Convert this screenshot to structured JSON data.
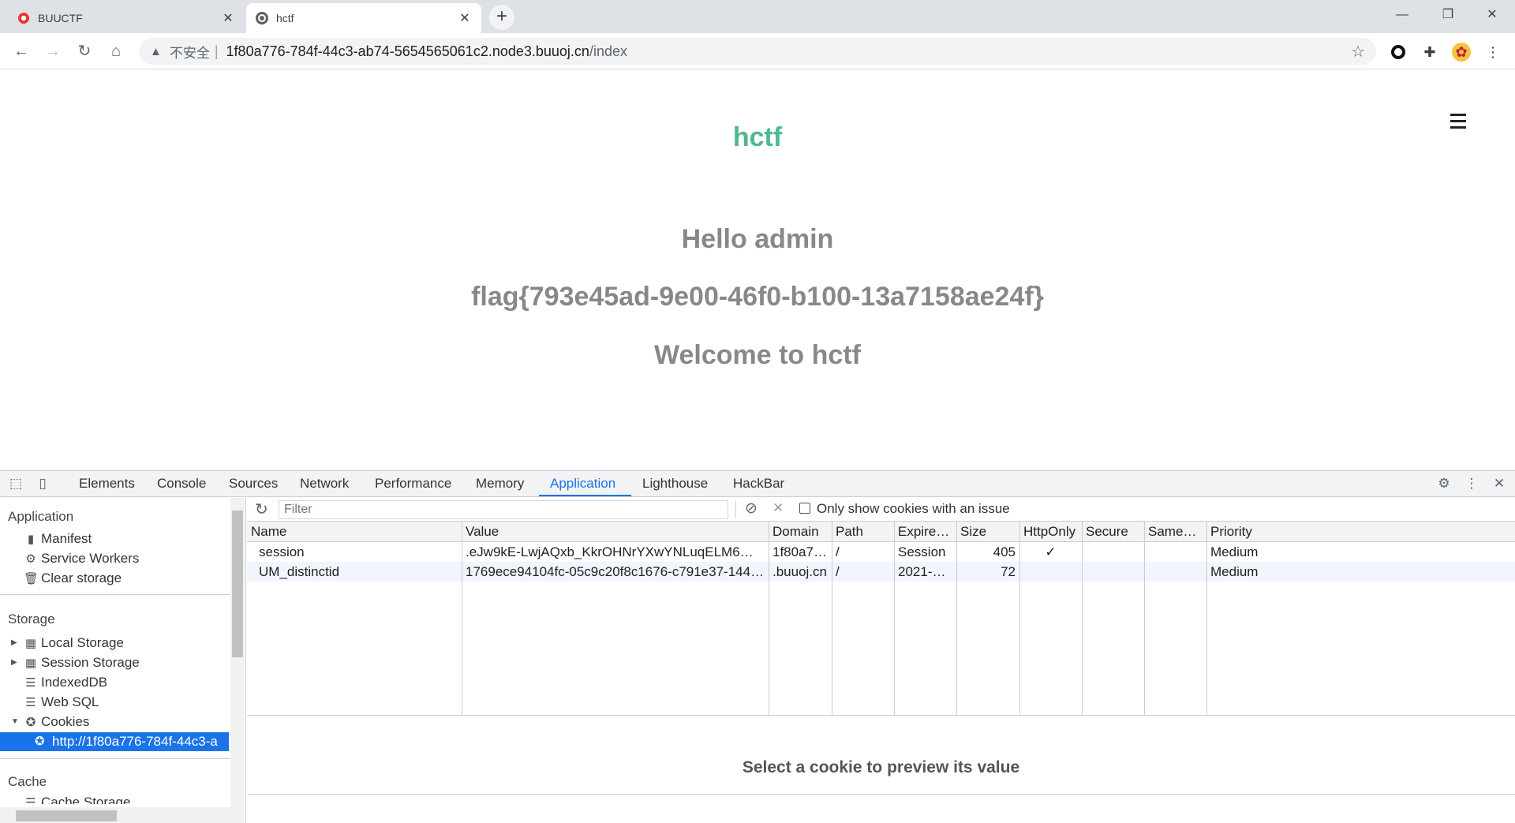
{
  "browser": {
    "tabs": [
      {
        "title": "BUUCTF",
        "favicon": "buuctf-logo-icon",
        "active": false
      },
      {
        "title": "hctf",
        "favicon": "globe-icon",
        "active": true
      }
    ],
    "address": {
      "security_label": "不安全",
      "host": "1f80a776-784f-44c3-ab74-5654565061c2.node3.buuoj.cn",
      "path": "/index"
    }
  },
  "page": {
    "brand": "hctf",
    "greeting": "Hello admin",
    "flag": "flag{793e45ad-9e00-46f0-b100-13a7158ae24f}",
    "welcome": "Welcome to hctf"
  },
  "devtools": {
    "tabs": [
      "Elements",
      "Console",
      "Sources",
      "Network",
      "Performance",
      "Memory",
      "Application",
      "Lighthouse",
      "HackBar"
    ],
    "active_tab": "Application",
    "sidebar": {
      "application_title": "Application",
      "application_items": [
        "Manifest",
        "Service Workers",
        "Clear storage"
      ],
      "storage_title": "Storage",
      "storage_items": [
        "Local Storage",
        "Session Storage",
        "IndexedDB",
        "Web SQL",
        "Cookies"
      ],
      "selected_cookie_origin": "http://1f80a776-784f-44c3-a",
      "cache_title": "Cache",
      "cache_partial_item": "Cache Storage"
    },
    "cookies": {
      "filter_placeholder": "Filter",
      "only_issues_label": "Only show cookies with an issue",
      "columns": [
        "Name",
        "Value",
        "Domain",
        "Path",
        "Expires / ...",
        "Size",
        "HttpOnly",
        "Secure",
        "SameSite",
        "Priority"
      ],
      "rows": [
        {
          "name": "session",
          "value": ".eJw9kE-LwjAQxb_KkrOHNrYXwYNLuqELM6WSWiYX8U-1S...",
          "domain": "1f80a776...",
          "path": "/",
          "expires": "Session",
          "size": "405",
          "httponly": "✓",
          "secure": "",
          "samesite": "",
          "priority": "Medium"
        },
        {
          "name": "UM_distinctid",
          "value": "1769ece94104fc-05c9c20f8c1676-c791e37-144000-1769e...",
          "domain": ".buuoj.cn",
          "path": "/",
          "expires": "2021-06-...",
          "size": "72",
          "httponly": "",
          "secure": "",
          "samesite": "",
          "priority": "Medium"
        }
      ],
      "preview_message": "Select a cookie to preview its value"
    }
  }
}
